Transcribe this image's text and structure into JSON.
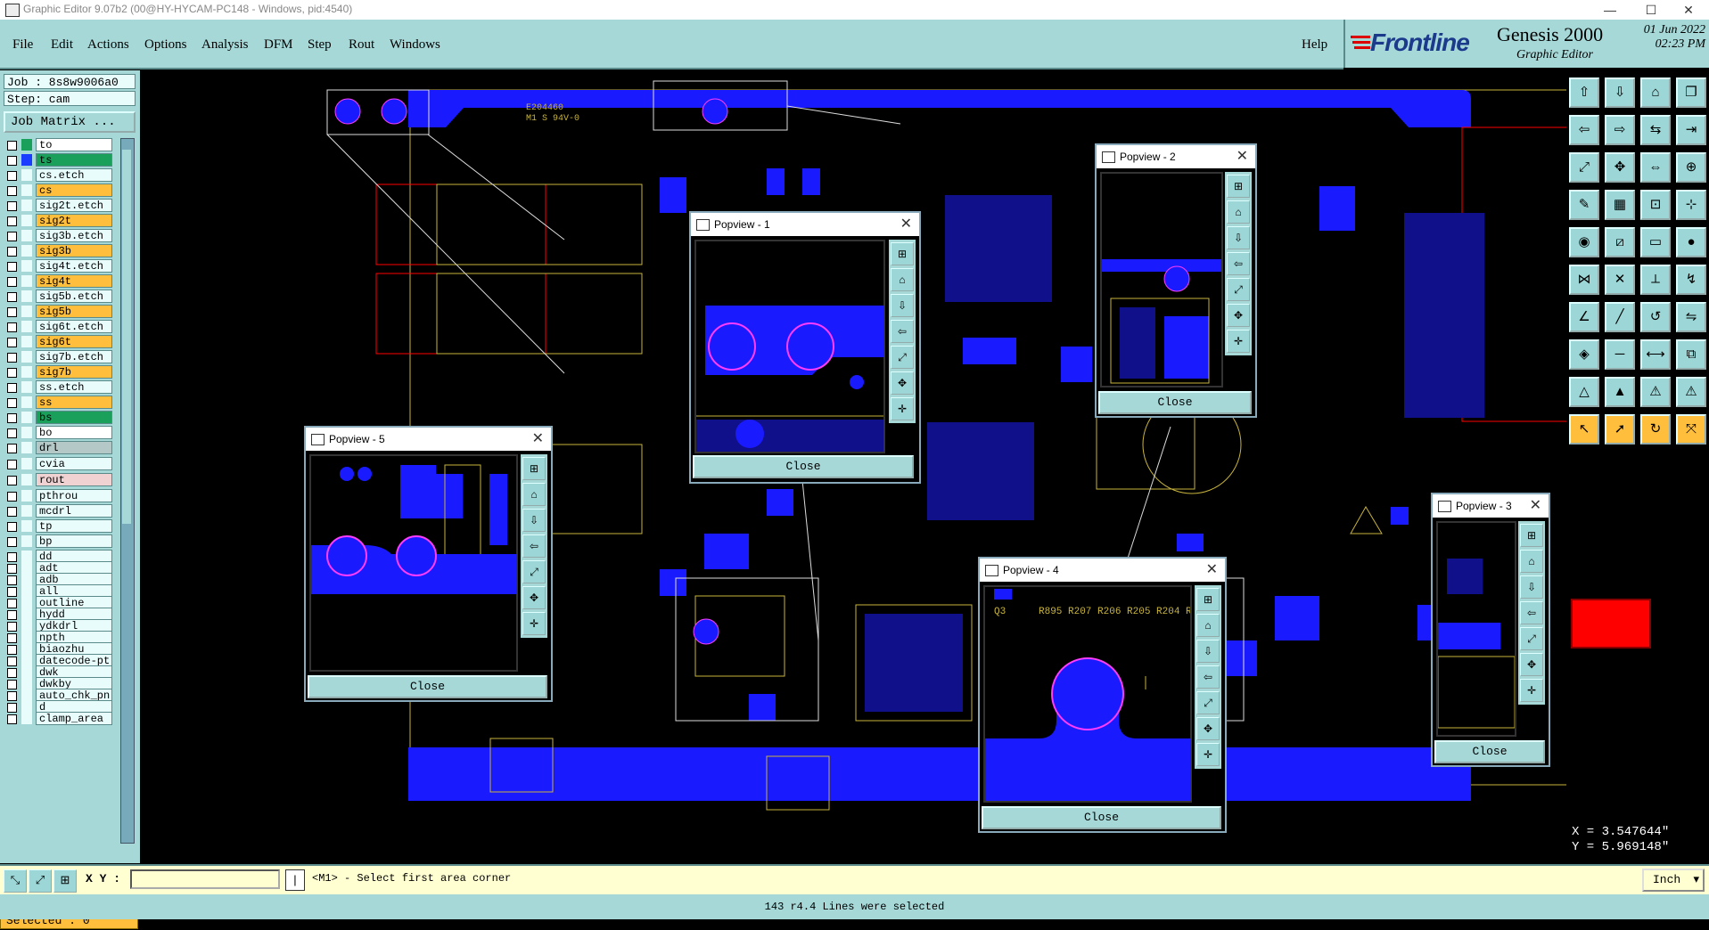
{
  "window": {
    "title": "Graphic Editor 9.07b2 (00@HY-HYCAM-PC148 - Windows, pid:4540)",
    "minimize": "—",
    "maximize": "☐",
    "close": "✕"
  },
  "menu": {
    "file": "File",
    "edit": "Edit",
    "actions": "Actions",
    "options": "Options",
    "analysis": "Analysis",
    "dfm": "DFM",
    "step": "Step",
    "rout": "Rout",
    "windows": "Windows",
    "help": "Help"
  },
  "logo": {
    "brand": "Frontline",
    "product": "Genesis 2000",
    "subtitle": "Graphic Editor",
    "date": "01 Jun 2022",
    "time": "02:23 PM"
  },
  "job": {
    "job_label": "Job : 8s8w9006a0",
    "step_label": "Step: cam",
    "matrix_button": "Job Matrix ..."
  },
  "layers": [
    {
      "name": "to",
      "color": "#ffffff",
      "sw": "#1aa05a"
    },
    {
      "name": "ts",
      "color": "#1aa05a",
      "sw": "#1a3cff"
    },
    {
      "name": "cs.etch",
      "color": "#e8fcfc",
      "sw": "#e8fcfc"
    },
    {
      "name": "cs",
      "color": "#ffbe3c",
      "sw": "#e8fcfc"
    },
    {
      "name": "sig2t.etch",
      "color": "#e8fcfc",
      "sw": "#e8fcfc"
    },
    {
      "name": "sig2t",
      "color": "#ffbe3c",
      "sw": "#e8fcfc"
    },
    {
      "name": "sig3b.etch",
      "color": "#e8fcfc",
      "sw": "#e8fcfc"
    },
    {
      "name": "sig3b",
      "color": "#ffbe3c",
      "sw": "#e8fcfc"
    },
    {
      "name": "sig4t.etch",
      "color": "#e8fcfc",
      "sw": "#e8fcfc"
    },
    {
      "name": "sig4t",
      "color": "#ffbe3c",
      "sw": "#e8fcfc"
    },
    {
      "name": "sig5b.etch",
      "color": "#e8fcfc",
      "sw": "#e8fcfc"
    },
    {
      "name": "sig5b",
      "color": "#ffbe3c",
      "sw": "#e8fcfc"
    },
    {
      "name": "sig6t.etch",
      "color": "#e8fcfc",
      "sw": "#e8fcfc"
    },
    {
      "name": "sig6t",
      "color": "#ffbe3c",
      "sw": "#e8fcfc"
    },
    {
      "name": "sig7b.etch",
      "color": "#e8fcfc",
      "sw": "#e8fcfc"
    },
    {
      "name": "sig7b",
      "color": "#ffbe3c",
      "sw": "#e8fcfc"
    },
    {
      "name": "ss.etch",
      "color": "#e8fcfc",
      "sw": "#e8fcfc"
    },
    {
      "name": "ss",
      "color": "#ffbe3c",
      "sw": "#e8fcfc"
    },
    {
      "name": "bs",
      "color": "#1aa05a",
      "sw": "#e8fcfc"
    },
    {
      "name": "bo",
      "color": "#ffffff",
      "sw": "#e8fcfc"
    },
    {
      "name": "drl",
      "color": "#b4c8c8",
      "sw": "#e8fcfc"
    },
    {
      "name": "cvia",
      "color": "#e8fcfc",
      "sw": "#e8fcfc"
    },
    {
      "name": "rout",
      "color": "#f0d2d2",
      "sw": "#e8fcfc"
    },
    {
      "name": "pthrou",
      "color": "#e8fcfc",
      "sw": "#e8fcfc"
    },
    {
      "name": "mcdrl",
      "color": "#e8fcfc",
      "sw": "#e8fcfc"
    },
    {
      "name": "tp",
      "color": "#e8fcfc",
      "sw": "#e8fcfc"
    },
    {
      "name": "bp",
      "color": "#e8fcfc",
      "sw": "#e8fcfc"
    },
    {
      "name": "dd",
      "color": "#e8fcfc",
      "sw": "#e8fcfc"
    },
    {
      "name": "adt",
      "color": "#e8fcfc",
      "sw": "#e8fcfc"
    },
    {
      "name": "adb",
      "color": "#e8fcfc",
      "sw": "#e8fcfc"
    },
    {
      "name": "all",
      "color": "#e8fcfc",
      "sw": "#e8fcfc"
    },
    {
      "name": "outline",
      "color": "#e8fcfc",
      "sw": "#e8fcfc"
    },
    {
      "name": "hydd",
      "color": "#e8fcfc",
      "sw": "#e8fcfc"
    },
    {
      "name": "ydkdrl",
      "color": "#e8fcfc",
      "sw": "#e8fcfc"
    },
    {
      "name": "npth",
      "color": "#e8fcfc",
      "sw": "#e8fcfc"
    },
    {
      "name": "biaozhu",
      "color": "#e8fcfc",
      "sw": "#e8fcfc"
    },
    {
      "name": "datecode-pt",
      "color": "#e8fcfc",
      "sw": "#e8fcfc"
    },
    {
      "name": "dwk",
      "color": "#e8fcfc",
      "sw": "#e8fcfc"
    },
    {
      "name": "dwkby",
      "color": "#e8fcfc",
      "sw": "#e8fcfc"
    },
    {
      "name": "auto_chk_pn",
      "color": "#e8fcfc",
      "sw": "#e8fcfc"
    },
    {
      "name": "d",
      "color": "#e8fcfc",
      "sw": "#e8fcfc"
    },
    {
      "name": "clamp_area",
      "color": "#e8fcfc",
      "sw": "#e8fcfc"
    }
  ],
  "selected": "Selected : 0",
  "popups": [
    {
      "title": "Popview - 1",
      "close": "Close"
    },
    {
      "title": "Popview - 2",
      "close": "Close"
    },
    {
      "title": "Popview - 3",
      "close": "Close"
    },
    {
      "title": "Popview - 4",
      "close": "Close"
    },
    {
      "title": "Popview - 5",
      "close": "Close"
    }
  ],
  "coords": {
    "x": "X = 3.547644\"",
    "y": "Y = 5.969148\""
  },
  "command": {
    "xy_label": "X Y :",
    "input_value": "",
    "prompt": "<M1> - Select first area corner",
    "units": "Inch"
  },
  "status": "143 r4.4 Lines were selected",
  "colors": {
    "panel": "#a6d8d8",
    "board": "#1a1aff",
    "silk": "#c8b43c",
    "pad_outline": "#ff3cff",
    "highlight": "#ff0000"
  }
}
